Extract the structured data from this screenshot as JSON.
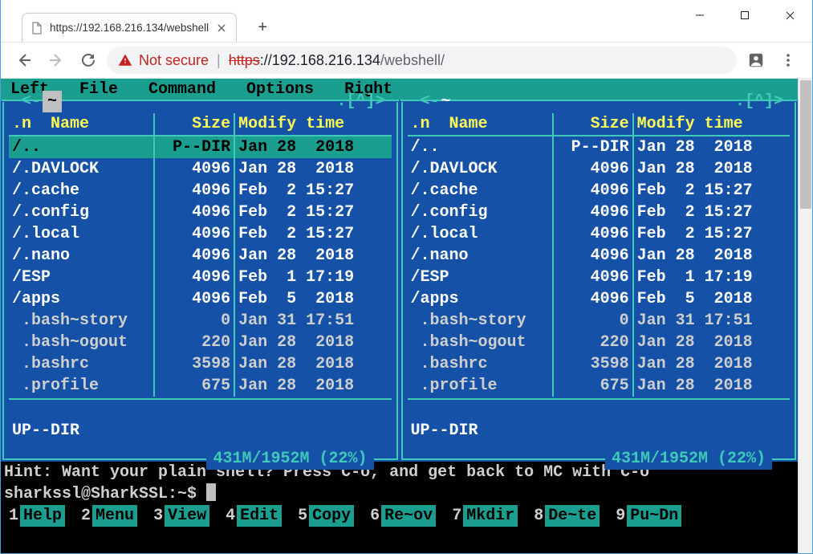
{
  "window": {
    "tab_title": "https://192.168.216.134/webshell",
    "new_tab_tooltip": "New tab"
  },
  "toolbar": {
    "not_secure": "Not secure",
    "protocol": "https",
    "host": "//192.168.216.134",
    "path": "/webshell/"
  },
  "mc_menu": [
    "Left",
    "File",
    "Command",
    "Options",
    "Right"
  ],
  "panel_header": {
    "left_arrow": "<-",
    "right_marker": ".[^]>",
    "path": "~",
    "cols": {
      "n": ".n",
      "name": "Name",
      "size": "Size",
      "modify": "Modify time"
    }
  },
  "left_rows": [
    {
      "name": "/..",
      "size": "P--DIR",
      "mod": "Jan 28  2018",
      "sel": true
    },
    {
      "name": "/.DAVLOCK",
      "size": "4096",
      "mod": "Jan 28  2018"
    },
    {
      "name": "/.cache",
      "size": "4096",
      "mod": "Feb  2 15:27"
    },
    {
      "name": "/.config",
      "size": "4096",
      "mod": "Feb  2 15:27"
    },
    {
      "name": "/.local",
      "size": "4096",
      "mod": "Feb  2 15:27"
    },
    {
      "name": "/.nano",
      "size": "4096",
      "mod": "Jan 28  2018"
    },
    {
      "name": "/ESP",
      "size": "4096",
      "mod": "Feb  1 17:19"
    },
    {
      "name": "/apps",
      "size": "4096",
      "mod": "Feb  5  2018"
    },
    {
      "name": " .bash~story",
      "size": "0",
      "mod": "Jan 31 17:51",
      "hid": true
    },
    {
      "name": " .bash~ogout",
      "size": "220",
      "mod": "Jan 28  2018",
      "hid": true
    },
    {
      "name": " .bashrc",
      "size": "3598",
      "mod": "Jan 28  2018",
      "hid": true
    },
    {
      "name": " .profile",
      "size": "675",
      "mod": "Jan 28  2018",
      "hid": true
    }
  ],
  "right_rows": [
    {
      "name": "/..",
      "size": "P--DIR",
      "mod": "Jan 28  2018"
    },
    {
      "name": "/.DAVLOCK",
      "size": "4096",
      "mod": "Jan 28  2018"
    },
    {
      "name": "/.cache",
      "size": "4096",
      "mod": "Feb  2 15:27"
    },
    {
      "name": "/.config",
      "size": "4096",
      "mod": "Feb  2 15:27"
    },
    {
      "name": "/.local",
      "size": "4096",
      "mod": "Feb  2 15:27"
    },
    {
      "name": "/.nano",
      "size": "4096",
      "mod": "Jan 28  2018"
    },
    {
      "name": "/ESP",
      "size": "4096",
      "mod": "Feb  1 17:19"
    },
    {
      "name": "/apps",
      "size": "4096",
      "mod": "Feb  5  2018"
    },
    {
      "name": " .bash~story",
      "size": "0",
      "mod": "Jan 31 17:51",
      "hid": true
    },
    {
      "name": " .bash~ogout",
      "size": "220",
      "mod": "Jan 28  2018",
      "hid": true
    },
    {
      "name": " .bashrc",
      "size": "3598",
      "mod": "Jan 28  2018",
      "hid": true
    },
    {
      "name": " .profile",
      "size": "675",
      "mod": "Jan 28  2018",
      "hid": true
    }
  ],
  "panel_footer": "UP--DIR",
  "disk_free": "431M/1952M (22%)",
  "hint": "Hint: Want your plain shell? Press C-o, and get back to MC with C-o",
  "prompt": "sharkssl@SharkSSL:~$ ",
  "fn_keys": [
    {
      "n": "1",
      "l": "Help"
    },
    {
      "n": "2",
      "l": "Menu"
    },
    {
      "n": "3",
      "l": "View"
    },
    {
      "n": "4",
      "l": "Edit"
    },
    {
      "n": "5",
      "l": "Copy"
    },
    {
      "n": "6",
      "l": "Re~ov"
    },
    {
      "n": "7",
      "l": "Mkdir"
    },
    {
      "n": "8",
      "l": "De~te"
    },
    {
      "n": "9",
      "l": "Pu~Dn"
    }
  ]
}
